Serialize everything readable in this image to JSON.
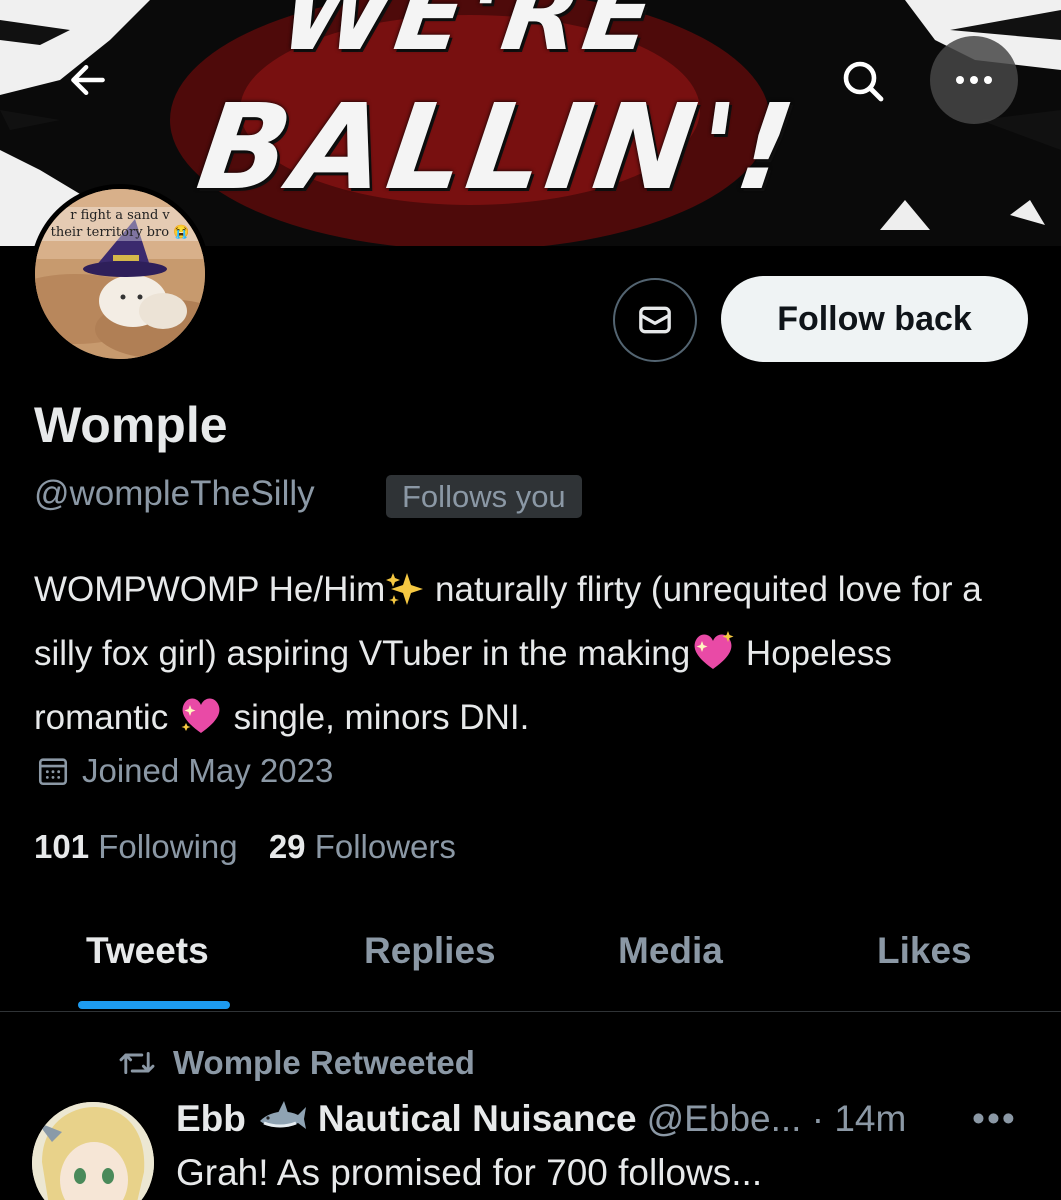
{
  "banner": {
    "line1": "WE'RE",
    "line2": "BALLIN'!"
  },
  "header": {
    "back_icon": "arrow-left-icon",
    "search_icon": "search-icon",
    "more_icon": "more-horizontal-icon"
  },
  "avatar": {
    "caption_line1": "r fight a sand v",
    "caption_line2": "their territory bro 😭"
  },
  "actions": {
    "message_icon": "envelope-icon",
    "follow_label": "Follow back"
  },
  "profile": {
    "display_name": "Womple",
    "handle": "@wompleTheSilly",
    "follows_you": "Follows you",
    "bio_part1": "WOMPWOMP He/Him",
    "bio_part2": " naturally flirty (unrequited love for a silly fox girl) aspiring VTuber in the making",
    "bio_part3": " Hopeless romantic ",
    "bio_part4": " single, minors DNI.",
    "joined": "Joined May 2023",
    "following_count": "101",
    "following_label": "Following",
    "followers_count": "29",
    "followers_label": "Followers"
  },
  "tabs": [
    {
      "label": "Tweets",
      "active": true
    },
    {
      "label": "Replies",
      "active": false
    },
    {
      "label": "Media",
      "active": false
    },
    {
      "label": "Likes",
      "active": false
    }
  ],
  "tweet": {
    "retweet_label": "Womple Retweeted",
    "author_part1": "Ebb",
    "author_part2": "Nautical Nuisance",
    "handle_time": "@Ebbe... · 14m",
    "more": "•••",
    "text": "Grah! As promised for 700 follows..."
  },
  "colors": {
    "background": "#000000",
    "text_primary": "#e7e9ea",
    "text_secondary": "#8b98a5",
    "accent": "#1d9bf0",
    "follow_button_bg": "#eff3f4"
  }
}
